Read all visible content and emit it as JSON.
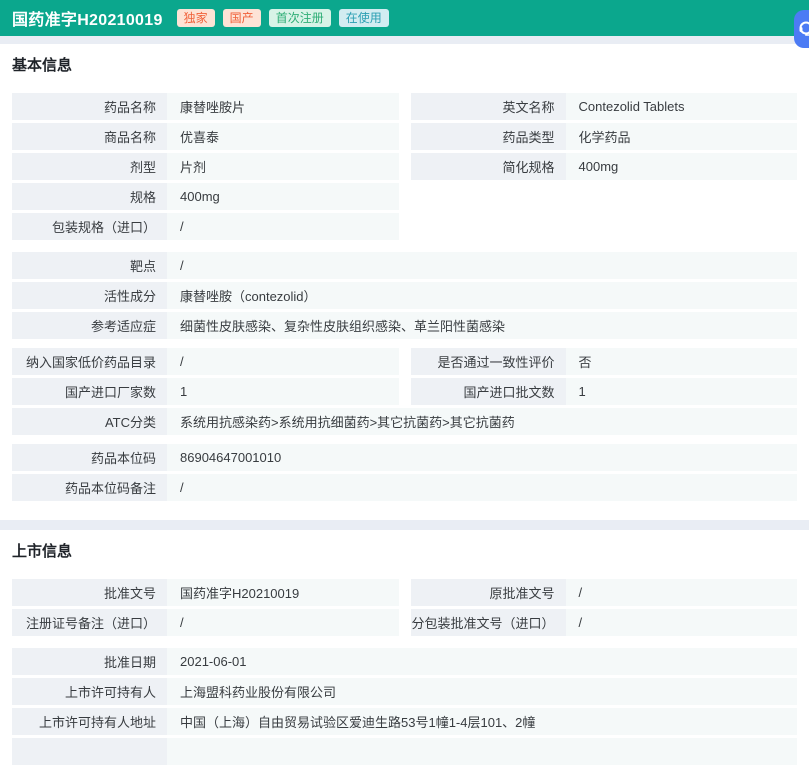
{
  "header": {
    "title": "国药准字H20210019",
    "badges": [
      {
        "label": "独家",
        "style": "orange"
      },
      {
        "label": "国产",
        "style": "orange"
      },
      {
        "label": "首次注册",
        "style": "green"
      },
      {
        "label": "在使用",
        "style": "cyan"
      }
    ]
  },
  "float_button": {
    "icon": "customer-service-icon"
  },
  "colors": {
    "header_bg": "#0ba78d",
    "page_bg": "#e9edf4",
    "label_cell_bg": "#eef1f5",
    "value_cell_bg": "#f5f9f9",
    "badge_orange_bg": "#fde3d6",
    "badge_orange_text": "#f0613a",
    "badge_green_bg": "#d8f3e7",
    "badge_green_text": "#2fae76",
    "badge_cyan_bg": "#d2ecf1",
    "badge_cyan_text": "#2b9fb3",
    "float_button_bg": "#4c7bf4"
  },
  "sections": [
    {
      "title": "基本信息",
      "groups": [
        {
          "type": "columns",
          "left": [
            {
              "label": "药品名称",
              "value": "康替唑胺片"
            },
            {
              "label": "商品名称",
              "value": "优喜泰"
            },
            {
              "label": "剂型",
              "value": "片剂"
            },
            {
              "label": "规格",
              "value": "400mg"
            },
            {
              "label": "包装规格（进口）",
              "value": "/"
            }
          ],
          "right": [
            {
              "label": "英文名称",
              "value": "Contezolid Tablets"
            },
            {
              "label": "药品类型",
              "value": "化学药品"
            },
            {
              "label": "简化规格",
              "value": "400mg"
            }
          ]
        },
        {
          "type": "full",
          "rows": [
            {
              "label": "靶点",
              "value": "/"
            },
            {
              "label": "活性成分",
              "value": "康替唑胺（contezolid）"
            },
            {
              "label": "参考适应症",
              "value": "细菌性皮肤感染、复杂性皮肤组织感染、革兰阳性菌感染"
            }
          ]
        },
        {
          "type": "columns",
          "left": [
            {
              "label": "纳入国家低价药品目录",
              "value": "/"
            },
            {
              "label": "国产进口厂家数",
              "value": "1"
            }
          ],
          "right": [
            {
              "label": "是否通过一致性评价",
              "value": "否"
            },
            {
              "label": "国产进口批文数",
              "value": "1"
            }
          ],
          "after_full": [
            {
              "label": "ATC分类",
              "value": "系统用抗感染药>系统用抗细菌药>其它抗菌药>其它抗菌药"
            }
          ]
        },
        {
          "type": "full",
          "rows": [
            {
              "label": "药品本位码",
              "value": "86904647001010"
            },
            {
              "label": "药品本位码备注",
              "value": "/"
            }
          ]
        }
      ]
    },
    {
      "title": "上市信息",
      "groups": [
        {
          "type": "columns",
          "left": [
            {
              "label": "批准文号",
              "value": "国药准字H20210019"
            },
            {
              "label": "注册证号备注（进口）",
              "value": "/"
            }
          ],
          "right": [
            {
              "label": "原批准文号",
              "value": "/"
            },
            {
              "label": "分包装批准文号（进口）",
              "value": "/"
            }
          ]
        },
        {
          "type": "full",
          "rows": [
            {
              "label": "批准日期",
              "value": "2021-06-01"
            },
            {
              "label": "上市许可持有人",
              "value": "上海盟科药业股份有限公司"
            },
            {
              "label": "上市许可持有人地址",
              "value": "中国（上海）自由贸易试验区爱迪生路53号1幢1-4层101、2幢"
            },
            {
              "label": "",
              "value": ""
            }
          ]
        }
      ]
    }
  ]
}
